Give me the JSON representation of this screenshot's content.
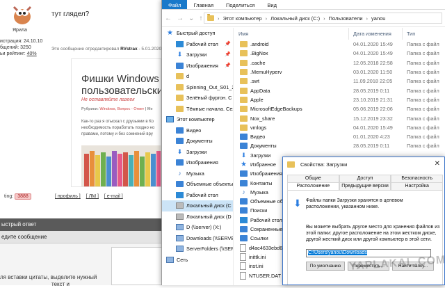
{
  "forum": {
    "username": "Ярила",
    "stats": [
      "истрация: 24.10.10",
      "бщений: 3250"
    ],
    "stats_rating_label": "ьи рейтинг:",
    "stats_rating_value": "40%",
    "post_title": "тут глядел?",
    "edit_note_prefix": "Это сообщение отредактировал",
    "edit_note_user": "RVstrax",
    "edit_note_date": "- 5.01.2020",
    "article": {
      "title_line1": "Фишки Windows",
      "title_line2": "пользовательски",
      "subtitle": "Не оставляйте лазеек",
      "category_prefix": "Рубрики:",
      "category_links": "Windows, Вопрос - Ответ",
      "category_suffix": "| Ме",
      "body": [
        "Как-то раз я отыскал с друзьями в Ко",
        "необходимость поработать поздно но",
        "правами, потому и без сомнений вру"
      ]
    },
    "rating_label": "ting:",
    "rating_value": "3888",
    "links": [
      "[ профиль ]",
      "[ ЛМ ]",
      "[ e-mail ]"
    ],
    "quick_reply_label": "ыстрый ответ",
    "enter_message_label": "едите сообщение",
    "hint_lines": [
      "ля вставки цитаты, выделите нужный",
      "текст и"
    ]
  },
  "explorer": {
    "ribbon_tabs": [
      "Файл",
      "Главная",
      "Поделиться",
      "Вид"
    ],
    "breadcrumb": [
      "Этот компьютер",
      "Локальный диск (C:)",
      "Пользователи",
      "yanou"
    ],
    "nav_items": [
      {
        "label": "Быстрый доступ",
        "icon": "star-icon",
        "root": true
      },
      {
        "label": "Рабочий стол",
        "icon": "desktop-icon",
        "pinned": true
      },
      {
        "label": "Загрузки",
        "icon": "download-icon",
        "pinned": true
      },
      {
        "label": "Изображения",
        "icon": "pictures-icon",
        "pinned": true
      },
      {
        "label": "d",
        "icon": "folder-icon"
      },
      {
        "label": "Spinning_Out_S01_2",
        "icon": "folder-icon"
      },
      {
        "label": "Зелёный фургон. С",
        "icon": "folder-icon"
      },
      {
        "label": "Тёмные начала. Сез",
        "icon": "folder-icon"
      },
      {
        "label": "Этот компьютер",
        "icon": "computer-icon",
        "root": true
      },
      {
        "label": "Видео",
        "icon": "video-icon"
      },
      {
        "label": "Документы",
        "icon": "documents-icon"
      },
      {
        "label": "Загрузки",
        "icon": "download-icon"
      },
      {
        "label": "Изображения",
        "icon": "pictures-icon"
      },
      {
        "label": "Музыка",
        "icon": "music-icon"
      },
      {
        "label": "Объемные объекты",
        "icon": "3d-objects-icon"
      },
      {
        "label": "Рабочий стол",
        "icon": "desktop-icon"
      },
      {
        "label": "Локальный диск (C",
        "icon": "drive-icon",
        "selected": true
      },
      {
        "label": "Локальный диск (D",
        "icon": "drive-icon"
      },
      {
        "label": "D (\\\\server) (X:)",
        "icon": "network-drive-icon"
      },
      {
        "label": "Downloads (\\\\SERVE",
        "icon": "network-drive-icon"
      },
      {
        "label": "ServerFolders (\\\\SER",
        "icon": "network-drive-icon"
      },
      {
        "label": "Сеть",
        "icon": "network-icon",
        "root": true
      }
    ],
    "columns": [
      "Имя",
      "Дата изменения",
      "Тип"
    ],
    "files": [
      {
        "name": ".android",
        "date": "04.01.2020 15:49",
        "type": "Папка с файл",
        "icon": "folder-icon"
      },
      {
        "name": ".BigNox",
        "date": "04.01.2020 15:49",
        "type": "Папка с файл",
        "icon": "folder-icon"
      },
      {
        "name": ".cache",
        "date": "12.05.2018 22:58",
        "type": "Папка с файл",
        "icon": "folder-icon"
      },
      {
        "name": ".MemuHyperv",
        "date": "03.01.2020 11:50",
        "type": "Папка с файл",
        "icon": "folder-icon"
      },
      {
        "name": ".swt",
        "date": "11.09.2018 22:05",
        "type": "Папка с файл",
        "icon": "folder-icon"
      },
      {
        "name": "AppData",
        "date": "28.05.2019 0:11",
        "type": "Папка с файл",
        "icon": "folder-icon"
      },
      {
        "name": "Apple",
        "date": "23.10.2019 21:31",
        "type": "Папка с файл",
        "icon": "folder-icon"
      },
      {
        "name": "MicrosoftEdgeBackups",
        "date": "05.06.2019 22:06",
        "type": "Папка с файл",
        "icon": "folder-icon"
      },
      {
        "name": "Nox_share",
        "date": "15.12.2019 23:32",
        "type": "Папка с файл",
        "icon": "folder-icon"
      },
      {
        "name": "vmlogs",
        "date": "04.01.2020 15:49",
        "type": "Папка с файл",
        "icon": "folder-icon"
      },
      {
        "name": "Видео",
        "date": "01.01.2020 4:23",
        "type": "Папка с файл",
        "icon": "video-icon"
      },
      {
        "name": "Документы",
        "date": "28.05.2019 0:11",
        "type": "Папка с файл",
        "icon": "documents-icon"
      },
      {
        "name": "Загрузки",
        "date": "",
        "type": "",
        "icon": "download-icon"
      },
      {
        "name": "Избранное",
        "date": "",
        "type": "",
        "icon": "star-icon"
      },
      {
        "name": "Изображения",
        "date": "",
        "type": "",
        "icon": "pictures-icon"
      },
      {
        "name": "Контакты",
        "date": "",
        "type": "",
        "icon": "contacts-icon"
      },
      {
        "name": "Музыка",
        "date": "",
        "type": "",
        "icon": "music-icon"
      },
      {
        "name": "Объемные объекты",
        "date": "",
        "type": "",
        "icon": "3d-objects-icon"
      },
      {
        "name": "Поиски",
        "date": "",
        "type": "",
        "icon": "search-icon"
      },
      {
        "name": "Рабочий стол",
        "date": "",
        "type": "",
        "icon": "desktop-icon"
      },
      {
        "name": "Сохраненные игры",
        "date": "",
        "type": "",
        "icon": "saved-games-icon"
      },
      {
        "name": "Ссылки",
        "date": "",
        "type": "",
        "icon": "links-icon"
      },
      {
        "name": "d4ac4633ebd6",
        "date": "",
        "type": "",
        "icon": "file-icon"
      },
      {
        "name": "inittk.ini",
        "date": "",
        "type": "",
        "icon": "file-icon"
      },
      {
        "name": "inst.ini",
        "date": "",
        "type": "",
        "icon": "file-icon"
      },
      {
        "name": "NTUSER.DAT",
        "date": "",
        "type": "",
        "icon": "file-icon"
      }
    ]
  },
  "dialog": {
    "title": "Свойства: Загрузки",
    "tabs_row1": [
      "Общие",
      "Доступ",
      "Безопасность"
    ],
    "tabs_row2": [
      "Расположение",
      "Предыдущие версии",
      "Настройка"
    ],
    "active_tab": "Расположение",
    "info": "Файлы папки Загрузки хранятся в целевом расположении, указанном ниже.",
    "description": "Вы можете выбрать другое место для хранения файлов из этой папки: другое расположение на этом жестком диске, другой жесткий диск или другой компьютер в этой сети.",
    "path_value": "C:\\Users\\yanou\\Downloads",
    "buttons": [
      "По умолчанию",
      "Переместить...",
      "Найти папку..."
    ],
    "watermark": "YAPLAKAL.COM"
  },
  "colors": {
    "accent": "#1979ca",
    "selection": "#cce4f7",
    "folder": "#e8c15a"
  }
}
